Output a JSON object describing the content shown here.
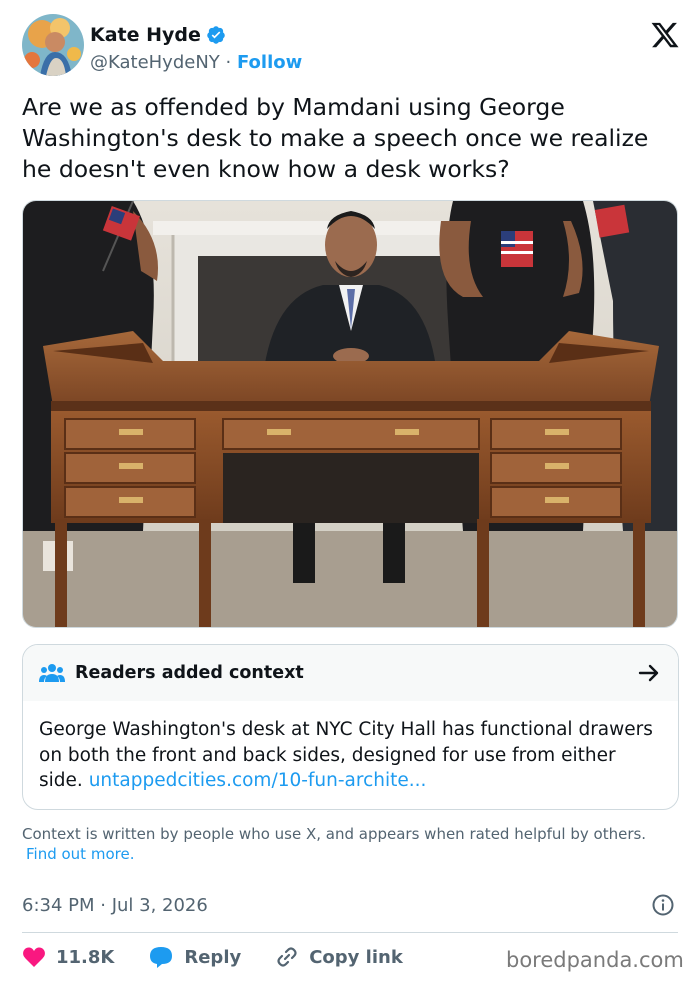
{
  "author": {
    "display_name": "Kate Hyde",
    "handle": "@KateHydeNY",
    "separator": " · ",
    "follow_label": "Follow",
    "avatar_icon": "avatar",
    "verified_icon": "verified-badge-icon"
  },
  "tweet": {
    "text": "Are we as offended by Mamdani using George Washington's desk to make a speech once we realize he doesn't even know how a desk works?",
    "media_icon": "photo"
  },
  "community_note": {
    "title": "Readers added context",
    "body": "George Washington's desk at NYC City Hall has functional drawers on both the front and back sides, designed for use from either side.",
    "link_text": "untappedcities.com/10-fun-archite...",
    "footer": "Context is written by people who use X, and appears when rated helpful by others.",
    "find_out_more": "Find out more."
  },
  "meta": {
    "timestamp": "6:34 PM · Jul 3, 2026"
  },
  "actions": {
    "likes_count": "11.8K",
    "reply_label": "Reply",
    "copy_link_label": "Copy link"
  },
  "watermark": "boredpanda.com",
  "colors": {
    "accent": "#1d9bf0",
    "heart": "#f91880",
    "text": "#0f1419",
    "secondary": "#536471"
  }
}
